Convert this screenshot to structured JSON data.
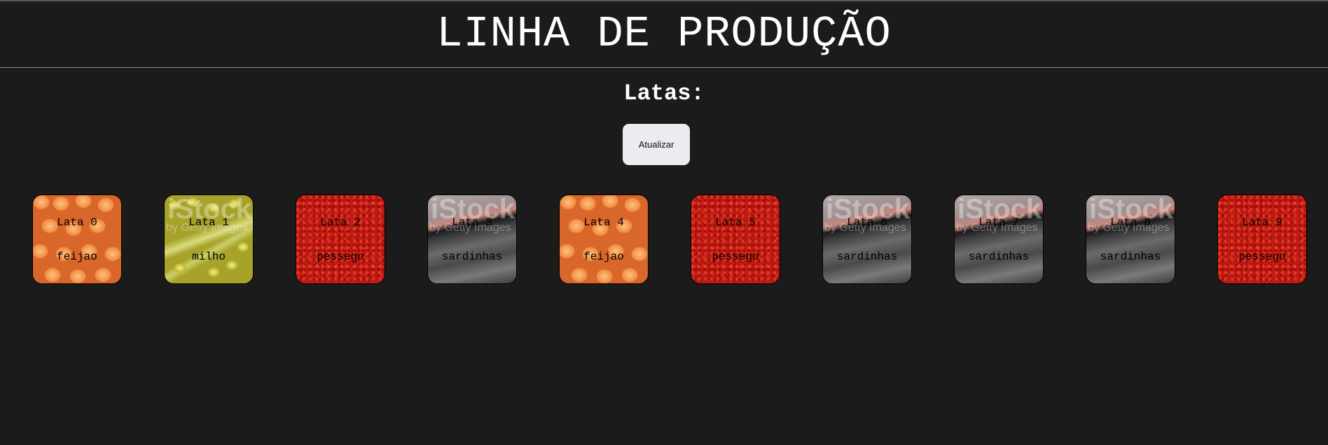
{
  "header": {
    "title": "LINHA DE PRODUÇÃO"
  },
  "section": {
    "subtitle": "Latas:"
  },
  "toolbar": {
    "refresh_label": "Atualizar"
  },
  "cans": [
    {
      "name": "Lata 0",
      "type": "feijao"
    },
    {
      "name": "Lata 1",
      "type": "milho"
    },
    {
      "name": "Lata 2",
      "type": "pessego"
    },
    {
      "name": "Lata 3",
      "type": "sardinhas"
    },
    {
      "name": "Lata 4",
      "type": "feijao"
    },
    {
      "name": "Lata 5",
      "type": "pessego"
    },
    {
      "name": "Lata 6",
      "type": "sardinhas"
    },
    {
      "name": "Lata 7",
      "type": "sardinhas"
    },
    {
      "name": "Lata 8",
      "type": "sardinhas"
    },
    {
      "name": "Lata 9",
      "type": "pessego"
    }
  ],
  "watermark": {
    "logo": "iStock",
    "line": "by Getty Images"
  }
}
